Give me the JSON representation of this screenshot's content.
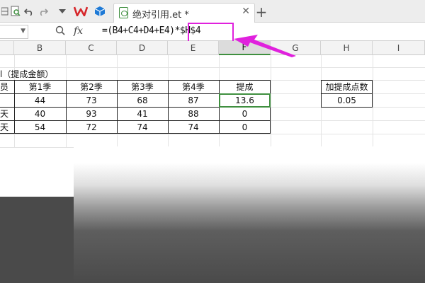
{
  "titlebar": {
    "doc_title": "绝对引用.et *",
    "close_glyph": "✕",
    "new_tab_glyph": "+"
  },
  "formula_bar": {
    "fx_label": "fx",
    "formula": "=(B4+C4+D4+E4)*$H$4"
  },
  "columns": [
    "B",
    "C",
    "D",
    "E",
    "F",
    "G",
    "H",
    "I"
  ],
  "active_column": "F",
  "sheet": {
    "caption": "l（提成金额）",
    "headers": [
      "员",
      "第1季",
      "第2季",
      "第3季",
      "第4季",
      "提成"
    ],
    "rows": [
      [
        "",
        "44",
        "73",
        "68",
        "87",
        "13.6"
      ],
      [
        "天",
        "40",
        "93",
        "41",
        "88",
        "0"
      ],
      [
        "天",
        "54",
        "72",
        "74",
        "74",
        "0"
      ]
    ],
    "rate_label": "加提成点数",
    "rate_value": "0.05"
  },
  "colors": {
    "accent_green": "#3f8f3f",
    "highlight_magenta": "#e021dd",
    "wps_red": "#d6262a",
    "cube_blue": "#1f7ad6"
  },
  "icons": [
    "grid-icon",
    "print-preview-icon",
    "undo-icon",
    "redo-icon",
    "dropdown-icon",
    "wps-logo-icon",
    "cube-icon",
    "spreadsheet-doc-icon",
    "zoom-icon"
  ]
}
